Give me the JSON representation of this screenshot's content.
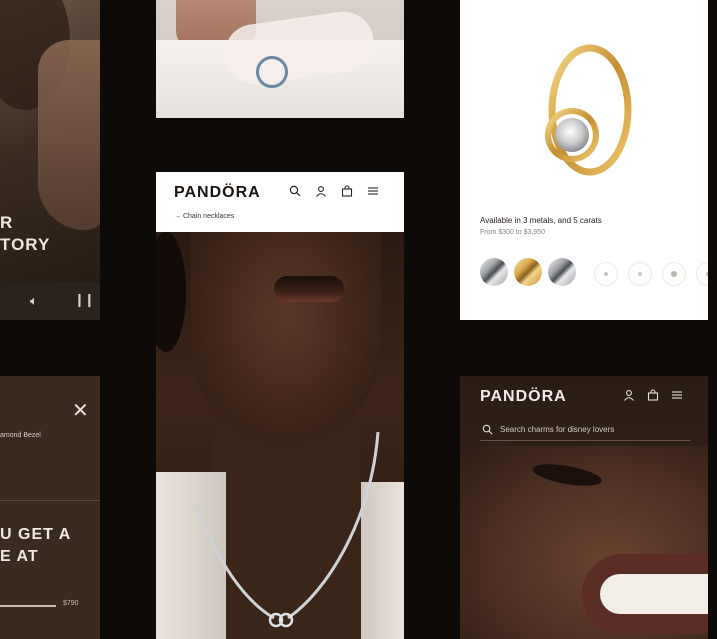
{
  "left_top": {
    "title_line1": "R",
    "title_line2": "TORY"
  },
  "left_bottom": {
    "product_name": "amond Bezel",
    "promo_line1": "U GET A",
    "promo_line2": "E AT",
    "price": "$790"
  },
  "mid_phone": {
    "brand": "PANDÖRA",
    "breadcrumb": "→ Chain necklaces"
  },
  "product_card": {
    "availability": "Available in 3 metals, and 5 carats",
    "price_range": "From $300 to $3,950",
    "swatches": [
      "silver",
      "gold",
      "silver"
    ]
  },
  "right_phone": {
    "brand": "PANDÖRA",
    "search_text": "Search charms for disney lovers"
  },
  "colors": {
    "background": "#0e0a08",
    "gold": "#d7a746",
    "brand_dark": "#1a1410"
  }
}
